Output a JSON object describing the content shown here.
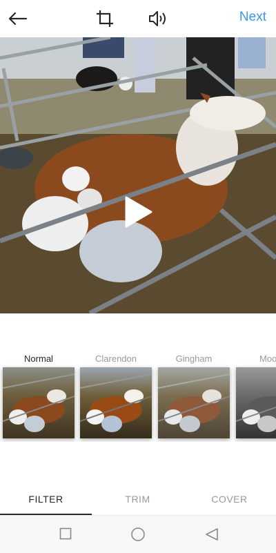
{
  "topbar": {
    "next_label": "Next"
  },
  "filters": [
    {
      "label": "Normal",
      "active": true
    },
    {
      "label": "Clarendon",
      "active": false
    },
    {
      "label": "Gingham",
      "active": false
    },
    {
      "label": "Moo",
      "active": false
    }
  ],
  "tabs": [
    {
      "label": "FILTER",
      "active": true
    },
    {
      "label": "TRIM",
      "active": false
    },
    {
      "label": "COVER",
      "active": false
    }
  ],
  "icons": [
    "back-arrow-icon",
    "crop-icon",
    "volume-icon",
    "play-icon",
    "square-icon",
    "circle-icon",
    "triangle-back-icon"
  ]
}
